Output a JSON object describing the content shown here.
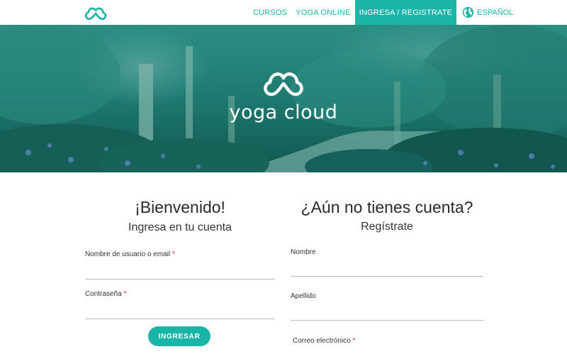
{
  "brand": {
    "name": "yoga cloud",
    "accent": "#1ab5a6"
  },
  "nav": {
    "items": [
      {
        "label": "CURSOS"
      },
      {
        "label": "YOGA ONLINE"
      },
      {
        "label": "INGRESA / REGISTRATE"
      }
    ],
    "language": {
      "icon": "globe-icon",
      "label": "ESPAÑOL"
    }
  },
  "login": {
    "title": "¡Bienvenido!",
    "subtitle": "Ingresa en tu cuenta",
    "fields": [
      {
        "label": "Nombre de usuario o email",
        "required": "*",
        "value": ""
      },
      {
        "label": "Contraseña",
        "required": "*",
        "value": ""
      }
    ],
    "submit_label": "INGRESAR"
  },
  "register": {
    "title": "¿Aún no tienes cuenta?",
    "subtitle": "Regístrate",
    "fields": [
      {
        "label": "Nombre",
        "value": ""
      },
      {
        "label": "Apellido",
        "value": ""
      },
      {
        "label": "Correo electrónico",
        "required": "*",
        "value": ""
      }
    ]
  }
}
